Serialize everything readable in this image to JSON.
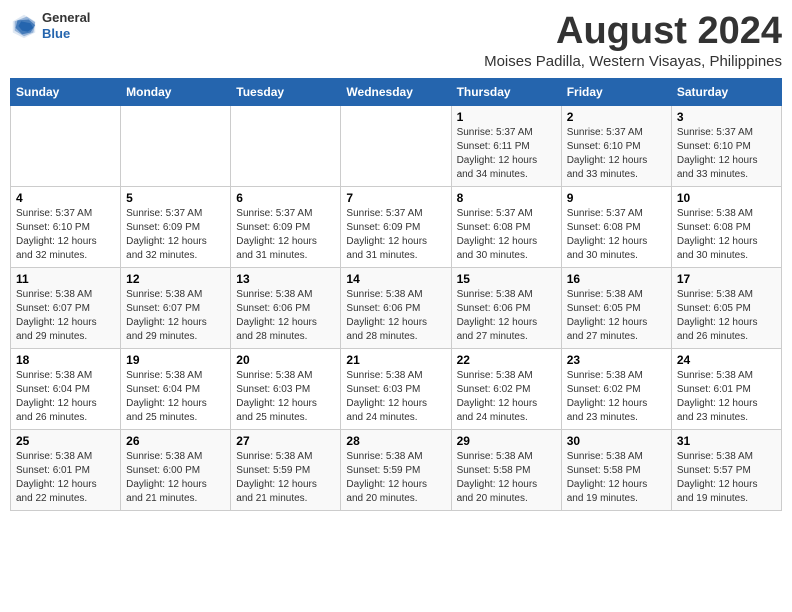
{
  "header": {
    "logo_line1": "General",
    "logo_line2": "Blue",
    "title": "August 2024",
    "subtitle": "Moises Padilla, Western Visayas, Philippines"
  },
  "days_of_week": [
    "Sunday",
    "Monday",
    "Tuesday",
    "Wednesday",
    "Thursday",
    "Friday",
    "Saturday"
  ],
  "weeks": [
    [
      {
        "day": "",
        "info": ""
      },
      {
        "day": "",
        "info": ""
      },
      {
        "day": "",
        "info": ""
      },
      {
        "day": "",
        "info": ""
      },
      {
        "day": "1",
        "info": "Sunrise: 5:37 AM\nSunset: 6:11 PM\nDaylight: 12 hours\nand 34 minutes."
      },
      {
        "day": "2",
        "info": "Sunrise: 5:37 AM\nSunset: 6:10 PM\nDaylight: 12 hours\nand 33 minutes."
      },
      {
        "day": "3",
        "info": "Sunrise: 5:37 AM\nSunset: 6:10 PM\nDaylight: 12 hours\nand 33 minutes."
      }
    ],
    [
      {
        "day": "4",
        "info": "Sunrise: 5:37 AM\nSunset: 6:10 PM\nDaylight: 12 hours\nand 32 minutes."
      },
      {
        "day": "5",
        "info": "Sunrise: 5:37 AM\nSunset: 6:09 PM\nDaylight: 12 hours\nand 32 minutes."
      },
      {
        "day": "6",
        "info": "Sunrise: 5:37 AM\nSunset: 6:09 PM\nDaylight: 12 hours\nand 31 minutes."
      },
      {
        "day": "7",
        "info": "Sunrise: 5:37 AM\nSunset: 6:09 PM\nDaylight: 12 hours\nand 31 minutes."
      },
      {
        "day": "8",
        "info": "Sunrise: 5:37 AM\nSunset: 6:08 PM\nDaylight: 12 hours\nand 30 minutes."
      },
      {
        "day": "9",
        "info": "Sunrise: 5:37 AM\nSunset: 6:08 PM\nDaylight: 12 hours\nand 30 minutes."
      },
      {
        "day": "10",
        "info": "Sunrise: 5:38 AM\nSunset: 6:08 PM\nDaylight: 12 hours\nand 30 minutes."
      }
    ],
    [
      {
        "day": "11",
        "info": "Sunrise: 5:38 AM\nSunset: 6:07 PM\nDaylight: 12 hours\nand 29 minutes."
      },
      {
        "day": "12",
        "info": "Sunrise: 5:38 AM\nSunset: 6:07 PM\nDaylight: 12 hours\nand 29 minutes."
      },
      {
        "day": "13",
        "info": "Sunrise: 5:38 AM\nSunset: 6:06 PM\nDaylight: 12 hours\nand 28 minutes."
      },
      {
        "day": "14",
        "info": "Sunrise: 5:38 AM\nSunset: 6:06 PM\nDaylight: 12 hours\nand 28 minutes."
      },
      {
        "day": "15",
        "info": "Sunrise: 5:38 AM\nSunset: 6:06 PM\nDaylight: 12 hours\nand 27 minutes."
      },
      {
        "day": "16",
        "info": "Sunrise: 5:38 AM\nSunset: 6:05 PM\nDaylight: 12 hours\nand 27 minutes."
      },
      {
        "day": "17",
        "info": "Sunrise: 5:38 AM\nSunset: 6:05 PM\nDaylight: 12 hours\nand 26 minutes."
      }
    ],
    [
      {
        "day": "18",
        "info": "Sunrise: 5:38 AM\nSunset: 6:04 PM\nDaylight: 12 hours\nand 26 minutes."
      },
      {
        "day": "19",
        "info": "Sunrise: 5:38 AM\nSunset: 6:04 PM\nDaylight: 12 hours\nand 25 minutes."
      },
      {
        "day": "20",
        "info": "Sunrise: 5:38 AM\nSunset: 6:03 PM\nDaylight: 12 hours\nand 25 minutes."
      },
      {
        "day": "21",
        "info": "Sunrise: 5:38 AM\nSunset: 6:03 PM\nDaylight: 12 hours\nand 24 minutes."
      },
      {
        "day": "22",
        "info": "Sunrise: 5:38 AM\nSunset: 6:02 PM\nDaylight: 12 hours\nand 24 minutes."
      },
      {
        "day": "23",
        "info": "Sunrise: 5:38 AM\nSunset: 6:02 PM\nDaylight: 12 hours\nand 23 minutes."
      },
      {
        "day": "24",
        "info": "Sunrise: 5:38 AM\nSunset: 6:01 PM\nDaylight: 12 hours\nand 23 minutes."
      }
    ],
    [
      {
        "day": "25",
        "info": "Sunrise: 5:38 AM\nSunset: 6:01 PM\nDaylight: 12 hours\nand 22 minutes."
      },
      {
        "day": "26",
        "info": "Sunrise: 5:38 AM\nSunset: 6:00 PM\nDaylight: 12 hours\nand 21 minutes."
      },
      {
        "day": "27",
        "info": "Sunrise: 5:38 AM\nSunset: 5:59 PM\nDaylight: 12 hours\nand 21 minutes."
      },
      {
        "day": "28",
        "info": "Sunrise: 5:38 AM\nSunset: 5:59 PM\nDaylight: 12 hours\nand 20 minutes."
      },
      {
        "day": "29",
        "info": "Sunrise: 5:38 AM\nSunset: 5:58 PM\nDaylight: 12 hours\nand 20 minutes."
      },
      {
        "day": "30",
        "info": "Sunrise: 5:38 AM\nSunset: 5:58 PM\nDaylight: 12 hours\nand 19 minutes."
      },
      {
        "day": "31",
        "info": "Sunrise: 5:38 AM\nSunset: 5:57 PM\nDaylight: 12 hours\nand 19 minutes."
      }
    ]
  ]
}
